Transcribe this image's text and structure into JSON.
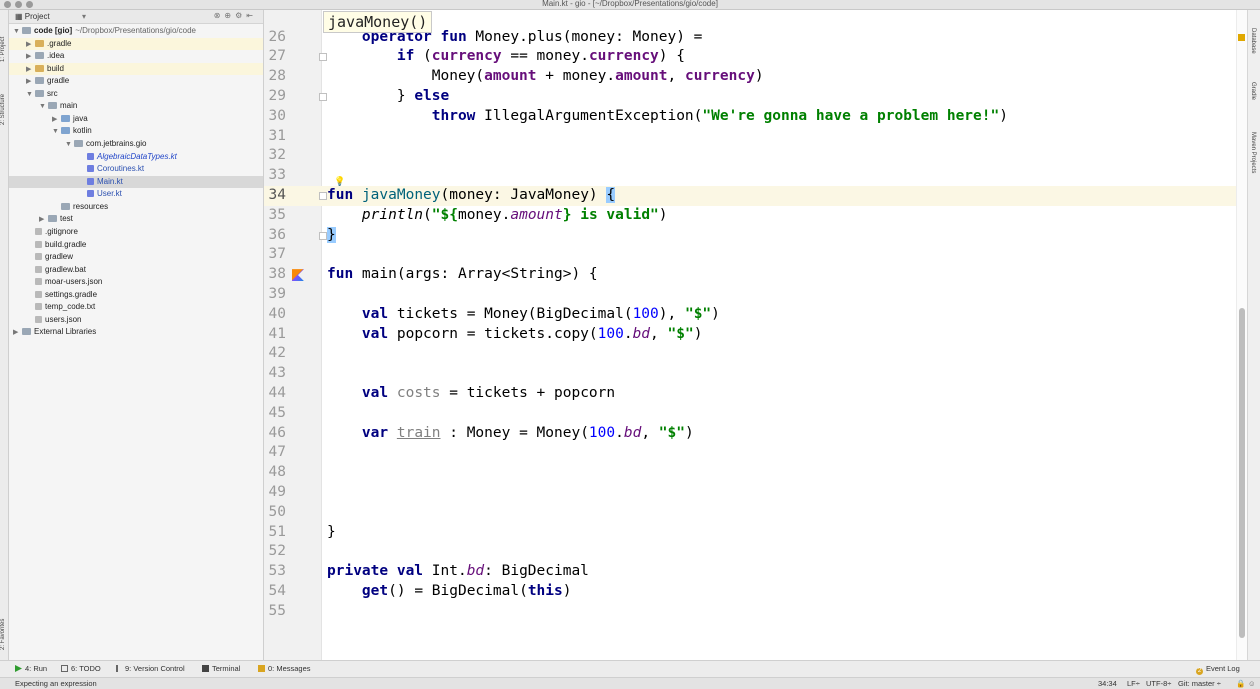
{
  "window": {
    "title": "Main.kt - gio - [~/Dropbox/Presentations/gio/code]"
  },
  "left_strip": {
    "top_tabs": [
      "1: Project",
      "2: Structure"
    ],
    "bottom_tabs": [
      "2: Favorites"
    ]
  },
  "right_strip": {
    "tabs": [
      "Database",
      "Gradle",
      "Maven Projects"
    ]
  },
  "project_panel": {
    "title": "Project",
    "tree": [
      {
        "label": "code [gio]",
        "path": "~/Dropbox/Presentations/gio/code",
        "depth": 0,
        "arrow": "▼",
        "icon": "folder"
      },
      {
        "label": ".gradle",
        "depth": 1,
        "arrow": "▶",
        "icon": "folder-yellow",
        "ignored": true
      },
      {
        "label": ".idea",
        "depth": 1,
        "arrow": "▶",
        "icon": "folder"
      },
      {
        "label": "build",
        "depth": 1,
        "arrow": "▶",
        "icon": "folder-yellow",
        "ignored": true
      },
      {
        "label": "gradle",
        "depth": 1,
        "arrow": "▶",
        "icon": "folder"
      },
      {
        "label": "src",
        "depth": 1,
        "arrow": "▼",
        "icon": "folder"
      },
      {
        "label": "main",
        "depth": 2,
        "arrow": "▼",
        "icon": "folder"
      },
      {
        "label": "java",
        "depth": 3,
        "arrow": "▶",
        "icon": "folder-blue"
      },
      {
        "label": "kotlin",
        "depth": 3,
        "arrow": "▼",
        "icon": "folder-blue"
      },
      {
        "label": "com.jetbrains.gio",
        "depth": 4,
        "arrow": "▼",
        "icon": "folder"
      },
      {
        "label": "AlgebraicDataTypes.kt",
        "depth": 5,
        "arrow": "",
        "icon": "kotlin-file",
        "error": true
      },
      {
        "label": "Coroutines.kt",
        "depth": 5,
        "arrow": "",
        "icon": "kotlin-file"
      },
      {
        "label": "Main.kt",
        "depth": 5,
        "arrow": "",
        "icon": "kotlin-file",
        "selected": true
      },
      {
        "label": "User.kt",
        "depth": 5,
        "arrow": "",
        "icon": "kotlin-file"
      },
      {
        "label": "resources",
        "depth": 3,
        "arrow": "",
        "icon": "folder"
      },
      {
        "label": "test",
        "depth": 2,
        "arrow": "▶",
        "icon": "folder"
      },
      {
        "label": ".gitignore",
        "depth": 1,
        "arrow": "",
        "icon": "file"
      },
      {
        "label": "build.gradle",
        "depth": 1,
        "arrow": "",
        "icon": "gradle-file"
      },
      {
        "label": "gradlew",
        "depth": 1,
        "arrow": "",
        "icon": "file"
      },
      {
        "label": "gradlew.bat",
        "depth": 1,
        "arrow": "",
        "icon": "file"
      },
      {
        "label": "moar-users.json",
        "depth": 1,
        "arrow": "",
        "icon": "file"
      },
      {
        "label": "settings.gradle",
        "depth": 1,
        "arrow": "",
        "icon": "gradle-file"
      },
      {
        "label": "temp_code.txt",
        "depth": 1,
        "arrow": "",
        "icon": "file"
      },
      {
        "label": "users.json",
        "depth": 1,
        "arrow": "",
        "icon": "file"
      },
      {
        "label": "External Libraries",
        "depth": 0,
        "arrow": "▶",
        "icon": "library"
      }
    ]
  },
  "editor": {
    "breadcrumb": "javaMoney()",
    "current_line": 34,
    "lines": [
      {
        "n": 26,
        "segs": [
          [
            "    ",
            ""
          ],
          [
            "operator fun",
            "kw"
          ],
          [
            " Money.plus(money: Money) =",
            ""
          ]
        ]
      },
      {
        "n": 27,
        "segs": [
          [
            "        ",
            ""
          ],
          [
            "if",
            "kw"
          ],
          [
            " (",
            ""
          ],
          [
            "currency",
            "fld"
          ],
          [
            " == money.",
            ""
          ],
          [
            "currency",
            "fld"
          ],
          [
            ") {",
            ""
          ]
        ]
      },
      {
        "n": 28,
        "segs": [
          [
            "            Money(",
            ""
          ],
          [
            "amount",
            "fld"
          ],
          [
            " + money.",
            ""
          ],
          [
            "amount",
            "fld"
          ],
          [
            ", ",
            ""
          ],
          [
            "currency",
            "fld"
          ],
          [
            ")",
            ""
          ]
        ]
      },
      {
        "n": 29,
        "segs": [
          [
            "        } ",
            ""
          ],
          [
            "else",
            "kw"
          ]
        ]
      },
      {
        "n": 30,
        "segs": [
          [
            "            ",
            ""
          ],
          [
            "throw",
            "kw"
          ],
          [
            " IllegalArgumentException(",
            ""
          ],
          [
            "\"We're gonna have a problem here!\"",
            "str"
          ],
          [
            ")",
            ""
          ]
        ]
      },
      {
        "n": 31,
        "segs": []
      },
      {
        "n": 32,
        "segs": []
      },
      {
        "n": 33,
        "segs": []
      },
      {
        "n": 34,
        "segs": [
          [
            "fun",
            "kw"
          ],
          [
            " ",
            ""
          ],
          [
            "javaMoney",
            "fdecl"
          ],
          [
            "(money: JavaMoney) ",
            ""
          ],
          [
            "{",
            "brace"
          ]
        ]
      },
      {
        "n": 35,
        "segs": [
          [
            "    ",
            ""
          ],
          [
            "println",
            "ital"
          ],
          [
            "(",
            ""
          ],
          [
            "\"${",
            "str"
          ],
          [
            "money.",
            ""
          ],
          [
            "amount",
            "itfld"
          ],
          [
            "}",
            "str"
          ],
          [
            " is valid\"",
            "str"
          ],
          [
            ")",
            ""
          ]
        ]
      },
      {
        "n": 36,
        "segs": [
          [
            "}",
            "brace"
          ]
        ]
      },
      {
        "n": 37,
        "segs": []
      },
      {
        "n": 38,
        "segs": [
          [
            "fun",
            "kw"
          ],
          [
            " main(args: Array<String>) {",
            ""
          ]
        ]
      },
      {
        "n": 39,
        "segs": []
      },
      {
        "n": 40,
        "segs": [
          [
            "    ",
            ""
          ],
          [
            "val",
            "kw"
          ],
          [
            " tickets = Money(BigDecimal(",
            ""
          ],
          [
            "100",
            "num"
          ],
          [
            "), ",
            ""
          ],
          [
            "\"$\"",
            "str"
          ],
          [
            ")",
            ""
          ]
        ]
      },
      {
        "n": 41,
        "segs": [
          [
            "    ",
            ""
          ],
          [
            "val",
            "kw"
          ],
          [
            " popcorn = tickets.copy(",
            ""
          ],
          [
            "100",
            "num"
          ],
          [
            ".",
            ""
          ],
          [
            "bd",
            "itfld"
          ],
          [
            ", ",
            ""
          ],
          [
            "\"$\"",
            "str"
          ],
          [
            ")",
            ""
          ]
        ]
      },
      {
        "n": 42,
        "segs": []
      },
      {
        "n": 43,
        "segs": []
      },
      {
        "n": 44,
        "segs": [
          [
            "    ",
            ""
          ],
          [
            "val",
            "kw"
          ],
          [
            " ",
            ""
          ],
          [
            "costs",
            "unused"
          ],
          [
            " = tickets + popcorn",
            ""
          ]
        ]
      },
      {
        "n": 45,
        "segs": []
      },
      {
        "n": 46,
        "segs": [
          [
            "    ",
            ""
          ],
          [
            "var",
            "kw"
          ],
          [
            " ",
            ""
          ],
          [
            "train",
            "uline"
          ],
          [
            " : Money = Money(",
            ""
          ],
          [
            "100",
            "num"
          ],
          [
            ".",
            ""
          ],
          [
            "bd",
            "itfld"
          ],
          [
            ", ",
            ""
          ],
          [
            "\"$\"",
            "str"
          ],
          [
            ")",
            ""
          ]
        ]
      },
      {
        "n": 47,
        "segs": []
      },
      {
        "n": 48,
        "segs": []
      },
      {
        "n": 49,
        "segs": []
      },
      {
        "n": 50,
        "segs": []
      },
      {
        "n": 51,
        "segs": [
          [
            "}",
            ""
          ]
        ]
      },
      {
        "n": 52,
        "segs": []
      },
      {
        "n": 53,
        "segs": [
          [
            "private val",
            "kw"
          ],
          [
            " Int.",
            ""
          ],
          [
            "bd",
            "itfld"
          ],
          [
            ": BigDecimal",
            ""
          ]
        ]
      },
      {
        "n": 54,
        "segs": [
          [
            "    ",
            ""
          ],
          [
            "get",
            "kw"
          ],
          [
            "() = BigDecimal(",
            ""
          ],
          [
            "this",
            "kw"
          ],
          [
            ")",
            ""
          ]
        ]
      },
      {
        "n": 55,
        "segs": []
      }
    ]
  },
  "bottom_tabs": [
    {
      "label": "4: Run",
      "icon": "run-icon",
      "color": "#2e9b2e"
    },
    {
      "label": "6: TODO",
      "icon": "todo-icon",
      "color": "#555555"
    },
    {
      "label": "9: Version Control",
      "icon": "vcs-icon",
      "color": "#555555"
    },
    {
      "label": "Terminal",
      "icon": "terminal-icon",
      "color": "#555555"
    },
    {
      "label": "0: Messages",
      "icon": "messages-icon",
      "color": "#d9a520"
    }
  ],
  "event_log": {
    "label": "Event Log",
    "badge": "2"
  },
  "status": {
    "message": "Expecting an expression",
    "position": "34:34",
    "line_sep": "LF÷",
    "encoding": "UTF-8÷",
    "vcs": "Git: master ÷"
  }
}
